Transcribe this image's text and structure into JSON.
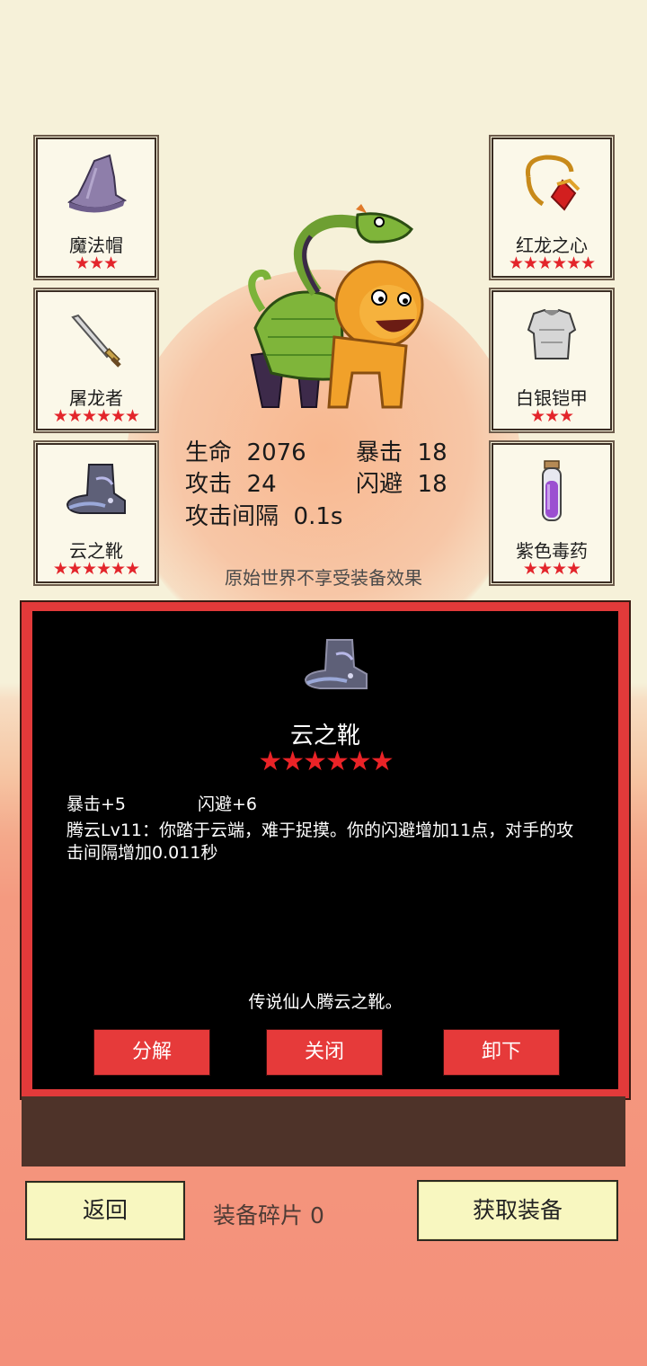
{
  "equipment": {
    "left": [
      {
        "name": "魔法帽",
        "stars": "★★★"
      },
      {
        "name": "屠龙者",
        "stars": "★★★★★★"
      },
      {
        "name": "云之靴",
        "stars": "★★★★★★"
      }
    ],
    "right": [
      {
        "name": "红龙之心",
        "stars": "★★★★★★"
      },
      {
        "name": "白银铠甲",
        "stars": "★★★"
      },
      {
        "name": "紫色毒药",
        "stars": "★★★★"
      }
    ]
  },
  "stats": {
    "hp_label": "生命",
    "hp_value": "2076",
    "crit_label": "暴击",
    "crit_value": "18",
    "atk_label": "攻击",
    "atk_value": "24",
    "dodge_label": "闪避",
    "dodge_value": "18",
    "interval_label": "攻击间隔",
    "interval_value": "0.1s"
  },
  "notice": "原始世界不享受装备效果",
  "detail": {
    "title": "云之靴",
    "stars": "★★★★★★",
    "attr1": "暴击+5",
    "attr2": "闪避+6",
    "description": "腾云Lv11：你踏于云端，难于捉摸。你的闪避增加11点，对手的攻击间隔增加0.011秒",
    "lore": "传说仙人腾云之靴。",
    "buttons": {
      "decompose": "分解",
      "close": "关闭",
      "unequip": "卸下"
    }
  },
  "footer": {
    "back": "返回",
    "shards_label": "装备碎片",
    "shards_value": "0",
    "get_equipment": "获取装备"
  },
  "colors": {
    "panel_red": "#e23a3a",
    "star_red": "#e3252b",
    "button_yellow": "#f8f7c0"
  }
}
